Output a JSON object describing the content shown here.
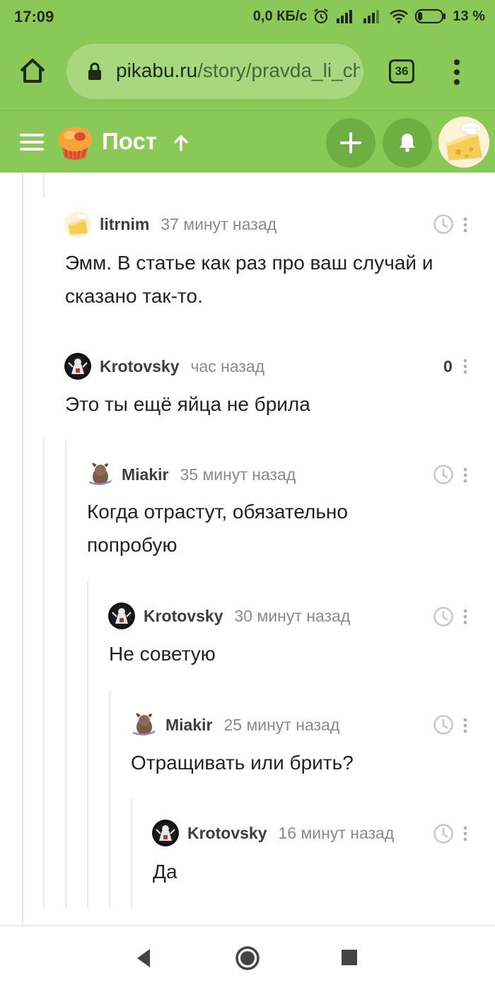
{
  "status_bar": {
    "time": "17:09",
    "network_speed": "0,0 КБ/с",
    "battery": "13 %",
    "icons": [
      "alarm-icon",
      "signal-icon",
      "signal-icon",
      "wifi-icon",
      "battery-icon"
    ]
  },
  "browser": {
    "url_host": "pikabu.ru",
    "url_path": "/story/pravda_li_ch",
    "tab_count": "36",
    "icons": [
      "home-icon",
      "lock-icon",
      "tabs-icon",
      "more-vert-icon"
    ]
  },
  "app_header": {
    "title": "Пост",
    "icons": [
      "hamburger-icon",
      "pikabu-logo",
      "up-arrow-icon",
      "plus-icon",
      "bell-icon",
      "avatar"
    ]
  },
  "comments": [
    {
      "user": "litrnim",
      "time": "37 минут назад",
      "text": "Эмм. В статье как раз про ваш случай и сказано так-то.",
      "depth": 0,
      "avatar": "cheese-avatar",
      "rating": null
    },
    {
      "user": "Krotovsky",
      "time": "час назад",
      "text": "Это ты ещё яйца не брила",
      "depth": 0,
      "avatar": "dark-avatar",
      "rating": "0"
    },
    {
      "user": "Miakir",
      "time": "35 минут назад",
      "text": "Когда отрастут, обязательно попробую",
      "depth": 1,
      "avatar": "creature-avatar",
      "rating": null
    },
    {
      "user": "Krotovsky",
      "time": "30 минут назад",
      "text": "Не советую",
      "depth": 2,
      "avatar": "dark-avatar",
      "rating": null
    },
    {
      "user": "Miakir",
      "time": "25 минут назад",
      "text": "Отращивать или брить?",
      "depth": 3,
      "avatar": "creature-avatar",
      "rating": null
    },
    {
      "user": "Krotovsky",
      "time": "16 минут назад",
      "text": "Да",
      "depth": 4,
      "avatar": "dark-avatar",
      "rating": null
    }
  ],
  "nav_bar": {
    "icons": [
      "back-icon",
      "home-circle-icon",
      "recents-icon"
    ]
  },
  "colors": {
    "header_green": "#8ac858",
    "button_green": "#6fae42",
    "url_box": "#a7d880"
  }
}
